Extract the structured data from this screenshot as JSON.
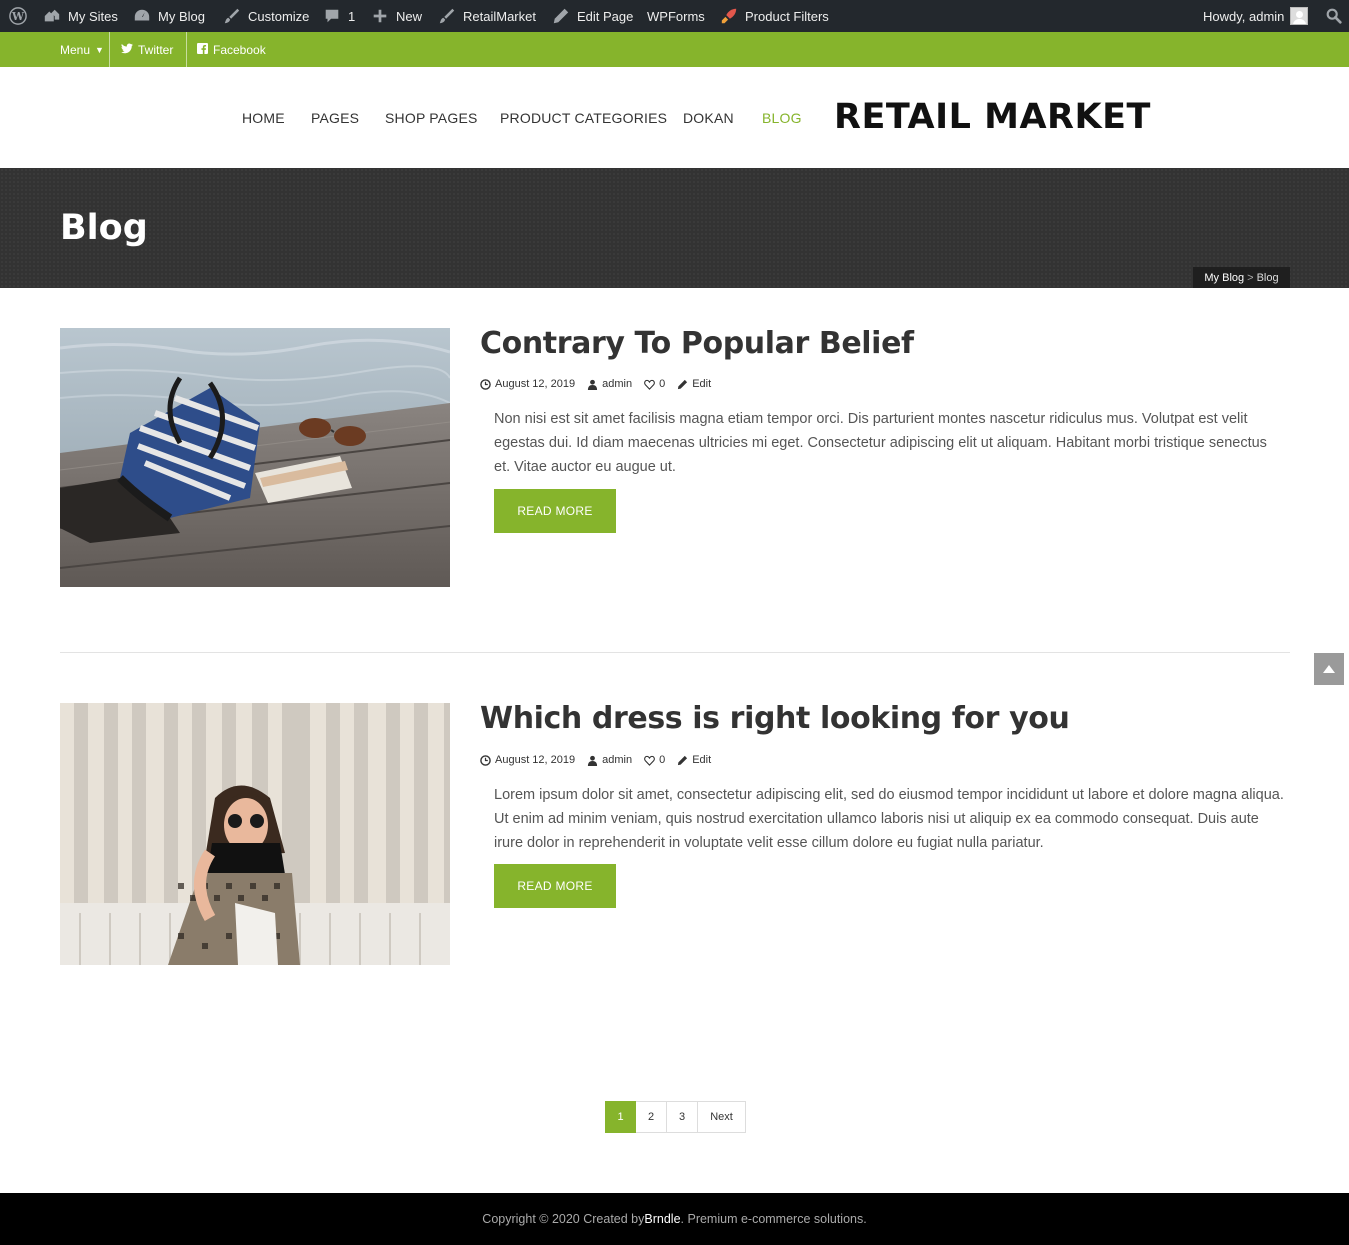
{
  "admin_bar": {
    "wp_logo_icon": "wordpress-icon",
    "my_sites": "My Sites",
    "my_blog": "My Blog",
    "customize": "Customize",
    "comments_count": "1",
    "new": "New",
    "site_name": "RetailMarket",
    "edit_page": "Edit Page",
    "wpforms": "WPForms",
    "product_filters": "Product Filters",
    "howdy": "Howdy, admin"
  },
  "topbar": {
    "menu": "Menu",
    "twitter": "Twitter",
    "facebook": "Facebook"
  },
  "nav": {
    "items": [
      "HOME",
      "PAGES",
      "SHOP PAGES",
      "PRODUCT CATEGORIES",
      "DOKAN",
      "BLOG"
    ],
    "active": "BLOG"
  },
  "logo": "RETAIL MARKET",
  "banner": {
    "title": "Blog",
    "breadcrumb_home": "My Blog",
    "breadcrumb_sep": ">",
    "breadcrumb_current": "Blog"
  },
  "posts": [
    {
      "title": "Contrary To Popular Belief",
      "date": "August 12, 2019",
      "author": "admin",
      "likes": "0",
      "edit": "Edit",
      "excerpt": "Non nisi est sit amet facilisis magna etiam tempor orci. Dis parturient montes nascetur ridiculus mus. Volutpat est velit egestas dui. Id diam maecenas ultricies mi eget. Consectetur adipiscing elit ut aliquam. Habitant morbi tristique senectus et. Vitae auctor eu augue ut.",
      "read_more": "READ MORE"
    },
    {
      "title": "Which dress is right looking for you",
      "date": "August 12, 2019",
      "author": "admin",
      "likes": "0",
      "edit": "Edit",
      "excerpt": "Lorem ipsum dolor sit amet, consectetur adipiscing elit, sed do eiusmod tempor incididunt ut labore et dolore magna aliqua. Ut enim ad minim veniam, quis nostrud exercitation ullamco laboris nisi ut aliquip ex ea commodo consequat. Duis aute irure dolor in reprehenderit in voluptate velit esse cillum dolore eu fugiat nulla pariatur.",
      "read_more": "READ MORE"
    }
  ],
  "pagination": {
    "pages": [
      "1",
      "2",
      "3"
    ],
    "current": "1",
    "next": "Next"
  },
  "footer": {
    "prefix": "Copyright © 2020 Created by ",
    "brand": "Brndle",
    "suffix": ". Premium e-commerce solutions."
  },
  "colors": {
    "accent": "#86b42c",
    "admin_bar": "#23282d",
    "banner": "#333333",
    "footer": "#000000"
  }
}
